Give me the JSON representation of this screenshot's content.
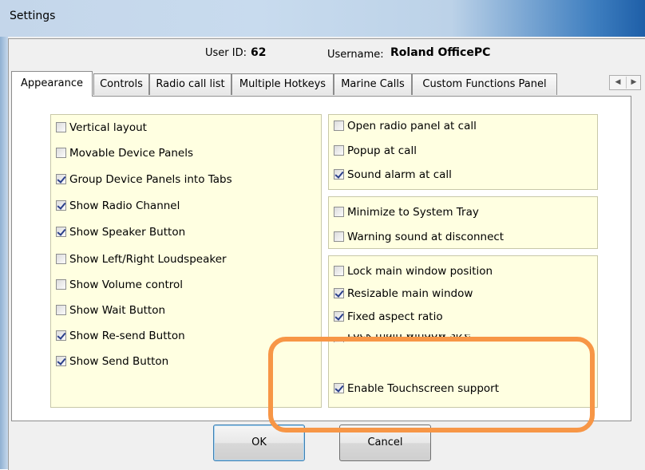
{
  "window": {
    "title": "Settings"
  },
  "user": {
    "id_label": "User ID:",
    "id_value": "62",
    "username_label": "Username:",
    "username_value": "Roland OfficePC"
  },
  "tabs": [
    {
      "label": "Appearance",
      "active": true
    },
    {
      "label": "Controls",
      "active": false
    },
    {
      "label": "Radio call list",
      "active": false
    },
    {
      "label": "Multiple Hotkeys",
      "active": false
    },
    {
      "label": "Marine Calls",
      "active": false
    },
    {
      "label": "Custom Functions Panel",
      "active": false
    }
  ],
  "tab_scroll": {
    "left_icon": "arrow-left-icon",
    "right_icon": "arrow-right-icon",
    "left_glyph": "◀",
    "right_glyph": "▶"
  },
  "left_panel": {
    "items": [
      {
        "label": "Vertical layout",
        "checked": false
      },
      {
        "label": "Movable Device Panels",
        "checked": false
      },
      {
        "label": "Group Device Panels into Tabs",
        "checked": true
      },
      {
        "label": "Show Radio Channel",
        "checked": true
      },
      {
        "label": "Show Speaker Button",
        "checked": true
      },
      {
        "label": "Show Left/Right Loudspeaker",
        "checked": false
      },
      {
        "label": "Show Volume control",
        "checked": false
      },
      {
        "label": "Show Wait Button",
        "checked": false
      },
      {
        "label": "Show Re-send Button",
        "checked": true
      },
      {
        "label": "Show Send Button",
        "checked": true
      }
    ]
  },
  "right_panel_call": {
    "items": [
      {
        "label": "Open radio panel at call",
        "checked": false
      },
      {
        "label": "Popup at call",
        "checked": false
      },
      {
        "label": "Sound alarm at call",
        "checked": true
      }
    ]
  },
  "right_panel_tray": {
    "items": [
      {
        "label": "Minimize to System Tray",
        "checked": false
      },
      {
        "label": "Warning sound at disconnect",
        "checked": false
      }
    ]
  },
  "right_panel_window": {
    "items": [
      {
        "label": "Lock main window position",
        "checked": false
      },
      {
        "label": "Resizable main window",
        "checked": true
      },
      {
        "label": "Fixed aspect ratio",
        "checked": true
      },
      {
        "label": "Lock main window size",
        "checked": false
      },
      {
        "label": "Enable Touchscreen support",
        "checked": true
      }
    ]
  },
  "buttons": {
    "ok_label": "OK",
    "cancel_label": "Cancel"
  },
  "colors": {
    "panel_bg": "#ffffe1",
    "highlight": "#f79646",
    "check": "#2a3f8a"
  }
}
